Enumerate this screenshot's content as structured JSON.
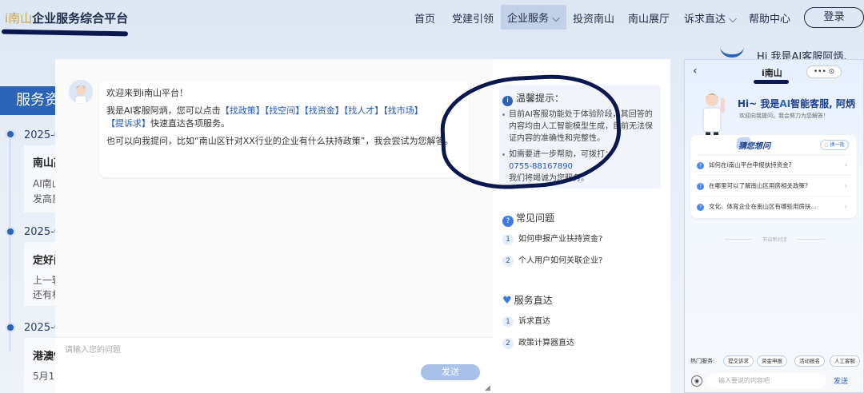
{
  "header": {
    "logo_prefix": "i南山",
    "logo_title": "企业服务综合平台",
    "nav": [
      "首页",
      "党建引领",
      "企业服务",
      "投资南山",
      "南山展厅",
      "诉求直达",
      "帮助中心"
    ],
    "login_label": "登录"
  },
  "background": {
    "section_title": "服务资",
    "items": [
      {
        "date": "2025-0",
        "title": "南山高",
        "lines": [
          "AI南山",
          "发高质"
        ]
      },
      {
        "date": "2025-0",
        "title": "定好间",
        "lines": [
          "上一轮",
          "还有机"
        ]
      },
      {
        "date": "2025-0",
        "title": "港澳慢",
        "lines": [
          "5月17"
        ]
      }
    ],
    "ai_peek": "Hi 我是AI客服阿炳,"
  },
  "chat": {
    "greeting": "欢迎来到i南山平台！",
    "intro_prefix": "我是AI客服阿炳，您可以点击",
    "links": [
      "【找政策】",
      "【找空间】",
      "【找资金】",
      "【找人才】",
      "【找市场】",
      "【提诉求】"
    ],
    "intro_suffix": "快速直达各项服务。",
    "hint": "也可以向我提问，比如“南山区针对XX行业的企业有什么扶持政策”，我会尝试为您解答。",
    "input_placeholder": "请输入您的问题",
    "send_label": "发送"
  },
  "tips": {
    "title": "温馨提示：",
    "line1": "目前AI客服功能处于体验阶段，其回答的内容均由人工智能模型生成，目前无法保证内容的准确性和完整性。",
    "line2": "如需要进一步帮助，可拨打：",
    "phone": "0755-88167890",
    "line3": "我们将竭诚为您服务。"
  },
  "faq": {
    "title": "常见问题",
    "items": [
      {
        "num": "1",
        "text": "如何申报产业扶持资金?"
      },
      {
        "num": "2",
        "text": "个人用户如何关联企业?"
      }
    ]
  },
  "direct": {
    "title": "服务直达",
    "items": [
      {
        "num": "1",
        "text": "诉求直达"
      },
      {
        "num": "2",
        "text": "政策计算器直达"
      }
    ]
  },
  "phone_panel": {
    "title": "i南山",
    "menu": "•••  ⊙",
    "hi_prefix": "Hi~ 我是",
    "hi_ai": "AI",
    "hi_suffix": "智能客服, 阿炳",
    "sub": "欢迎向我提问，我会努力为您解答！",
    "guess_title": "猜您想问",
    "refresh": "◌ 换一批",
    "questions": [
      "如何在i南山平台申报扶持资金?",
      "在哪里可以了解南山区用房相关政策?",
      "文化、体育企业在南山区有哪些用房扶..."
    ],
    "divider": "开启新对话",
    "hot_label": "热门服务:",
    "chips": [
      "提交诉求",
      "资金申报",
      "活动报名",
      "人工客服"
    ],
    "input_placeholder": "输入要说的内容吧",
    "send_label": "发送"
  }
}
